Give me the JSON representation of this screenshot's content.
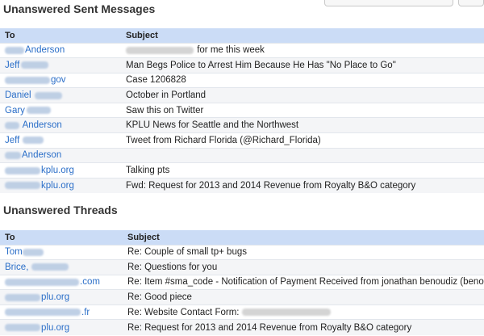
{
  "sections": {
    "sent": {
      "title": "Unanswered Sent Messages",
      "col_to": "To",
      "col_subject": "Subject",
      "rows": [
        {
          "to": "Anderson",
          "subject": "for me this week"
        },
        {
          "to": "Jeff",
          "subject": "Man Begs Police to Arrest Him Because He Has \"No Place to Go\""
        },
        {
          "to": "gov",
          "subject": "Case 1206828"
        },
        {
          "to": "Daniel",
          "subject": "October in Portland"
        },
        {
          "to": "Gary",
          "subject": "Saw this on Twitter"
        },
        {
          "to": "Anderson",
          "subject": "KPLU News for Seattle and the Northwest"
        },
        {
          "to": "Jeff",
          "subject": "Tweet from Richard Florida (@Richard_Florida)"
        },
        {
          "to": "Anderson",
          "subject": ""
        },
        {
          "to": "kplu.org",
          "subject": "Talking pts"
        },
        {
          "to": "kplu.org",
          "subject": "Fwd: Request for 2013 and 2014 Revenue from Royalty B&O category"
        }
      ]
    },
    "threads": {
      "title": "Unanswered Threads",
      "col_to": "To",
      "col_subject": "Subject",
      "rows": [
        {
          "to": "Tom",
          "subject": "Re: Couple of small tp+ bugs"
        },
        {
          "to": "Brice,",
          "subject": "Re: Questions for you"
        },
        {
          "to": ".com",
          "subject": "Re: Item #sma_code - Notification of Payment Received from jonathan benoudiz (benoudd@rocketmail.com)"
        },
        {
          "to": "plu.org",
          "subject": "Re: Good piece"
        },
        {
          "to": ".fr",
          "subject": "Re: Website Contact Form:"
        },
        {
          "to": "plu.org",
          "subject": "Re: Request for 2013 and 2014 Revenue from Royalty B&O category"
        }
      ]
    }
  },
  "colors": {
    "header_bg": "#cbdcf6",
    "link": "#2a6ec8",
    "alt_row": "#f4f5f7"
  }
}
